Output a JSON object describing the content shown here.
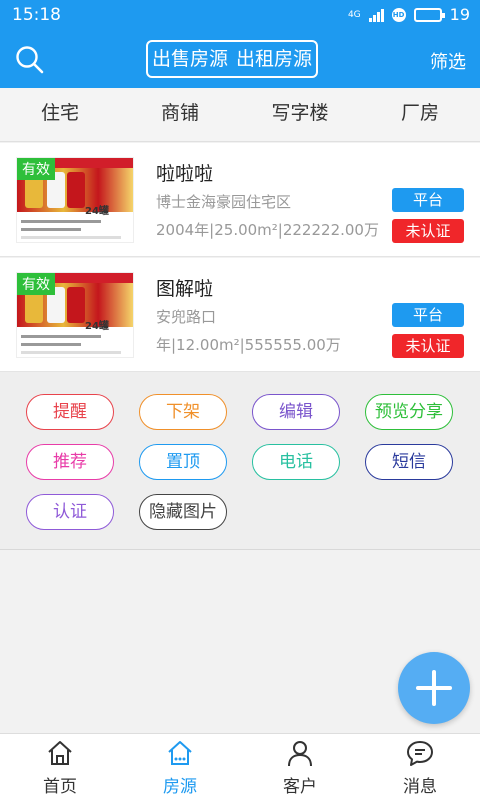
{
  "status_bar": {
    "time": "15:18",
    "network": "4G",
    "hd": "HD",
    "battery": "19"
  },
  "header": {
    "segments": [
      "出售房源",
      "出租房源"
    ],
    "active_segment": 0,
    "filter_label": "筛选"
  },
  "category_tabs": [
    "住宅",
    "商铺",
    "写字楼",
    "厂房"
  ],
  "active_category": 3,
  "listings": [
    {
      "badge": "有效",
      "title": "啦啦啦",
      "address": "博士金海豪园住宅区",
      "info": "2004年|25.00m²|222222.00万",
      "tag_platform": "平台",
      "tag_status": "未认证",
      "thumb_count": "24罐"
    },
    {
      "badge": "有效",
      "title": "图解啦",
      "address": "安兜路口",
      "info": "年|12.00m²|555555.00万",
      "tag_platform": "平台",
      "tag_status": "未认证",
      "thumb_count": "24罐"
    }
  ],
  "actions": [
    {
      "label": "提醒",
      "color": "#e8434c"
    },
    {
      "label": "下架",
      "color": "#f0902a"
    },
    {
      "label": "编辑",
      "color": "#7a55cc"
    },
    {
      "label": "预览分享",
      "color": "#2ebf3a"
    },
    {
      "label": "推荐",
      "color": "#e83ca8"
    },
    {
      "label": "置顶",
      "color": "#1e9af0"
    },
    {
      "label": "电话",
      "color": "#28c0a0"
    },
    {
      "label": "短信",
      "color": "#2a3a9c"
    },
    {
      "label": "认证",
      "color": "#8f5ad8"
    },
    {
      "label": "隐藏图片",
      "color": "#444444"
    }
  ],
  "bottom_nav": [
    {
      "label": "首页",
      "icon": "home-icon"
    },
    {
      "label": "房源",
      "icon": "listings-icon"
    },
    {
      "label": "客户",
      "icon": "user-icon"
    },
    {
      "label": "消息",
      "icon": "message-icon"
    }
  ],
  "active_nav": 1,
  "colors": {
    "primary": "#1e9af0",
    "valid_badge": "#2ebf3a",
    "uncertified": "#f0262a",
    "fab": "#55adf3"
  }
}
